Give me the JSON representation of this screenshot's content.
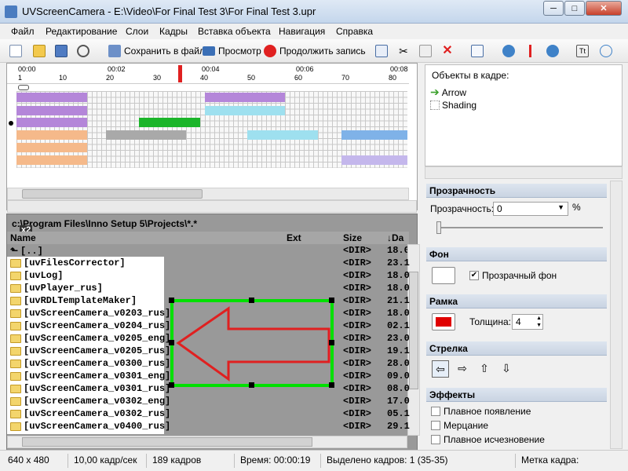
{
  "window": {
    "title": "UVScreenCamera - E:\\Video\\For Final Test 3\\For Final Test 3.upr",
    "min": "─",
    "max": "□",
    "close": "✕"
  },
  "menu": [
    "Файл",
    "Редактирование",
    "Слои",
    "Кадры",
    "Вставка объекта",
    "Навигация",
    "Справка"
  ],
  "toolbar": {
    "save_file": "Сохранить в файл",
    "preview": "Просмотр",
    "continue_rec": "Продолжить запись"
  },
  "ruler": {
    "times": [
      "00:00",
      "00:02",
      "00:04",
      "00:06",
      "00:08"
    ],
    "frames": [
      "1",
      "10",
      "20",
      "30",
      "40",
      "50",
      "60",
      "70",
      "80"
    ]
  },
  "timeline": {
    "zoom_badge": "x2"
  },
  "browser": {
    "path": "c:\\Program Files\\Inno Setup 5\\Projects\\*.*",
    "columns": {
      "name": "Name",
      "ext": "Ext",
      "size": "Size",
      "date": "↓Da"
    },
    "up": {
      "name": "[..]",
      "size": "<DIR>",
      "date": "18.0"
    },
    "rows": [
      {
        "name": "[uvFilesCorrector]",
        "size": "<DIR>",
        "date": "23.1"
      },
      {
        "name": "[uvLog]",
        "size": "<DIR>",
        "date": "18.0"
      },
      {
        "name": "[uvPlayer_rus]",
        "size": "<DIR>",
        "date": "18.0"
      },
      {
        "name": "[uvRDLTemplateMaker]",
        "size": "<DIR>",
        "date": "21.1"
      },
      {
        "name": "[uvScreenCamera_v0203_rus]",
        "size": "<DIR>",
        "date": "18.0"
      },
      {
        "name": "[uvScreenCamera_v0204_rus]",
        "size": "<DIR>",
        "date": "02.1"
      },
      {
        "name": "[uvScreenCamera_v0205_eng]",
        "size": "<DIR>",
        "date": "23.0"
      },
      {
        "name": "[uvScreenCamera_v0205_rus]",
        "size": "<DIR>",
        "date": "19.1"
      },
      {
        "name": "[uvScreenCamera_v0300_rus]",
        "size": "<DIR>",
        "date": "28.0"
      },
      {
        "name": "[uvScreenCamera_v0301_eng]",
        "size": "<DIR>",
        "date": "09.0"
      },
      {
        "name": "[uvScreenCamera_v0301_rus]",
        "size": "<DIR>",
        "date": "08.0"
      },
      {
        "name": "[uvScreenCamera_v0302_eng]",
        "size": "<DIR>",
        "date": "17.0"
      },
      {
        "name": "[uvScreenCamera_v0302_rus]",
        "size": "<DIR>",
        "date": "05.1"
      },
      {
        "name": "[uvScreenCamera_v0400_rus]",
        "size": "<DIR>",
        "date": "29.1"
      }
    ]
  },
  "objects": {
    "title": "Объекты в кадре:",
    "items": [
      "Arrow",
      "Shading"
    ]
  },
  "transparency": {
    "header": "Прозрачность",
    "label": "Прозрачность:",
    "value": "0",
    "unit": "%"
  },
  "background": {
    "header": "Фон",
    "checkbox": "Прозрачный фон"
  },
  "frame": {
    "header": "Рамка",
    "thickness_label": "Толщина:",
    "thickness": "4",
    "color": "#e00000"
  },
  "arrow": {
    "header": "Стрелка",
    "dirs": [
      "⇦",
      "⇨",
      "⇧",
      "⇩"
    ]
  },
  "effects": {
    "header": "Эффекты",
    "items": [
      "Плавное появление",
      "Мерцание",
      "Плавное исчезновение"
    ]
  },
  "status": {
    "resolution": "640 x 480",
    "fps": "10,00 кадр/сек",
    "frames": "189 кадров",
    "time": "Время: 00:00:19",
    "selected": "Выделено кадров: 1 (35-35)",
    "mark": "Метка кадра:"
  }
}
